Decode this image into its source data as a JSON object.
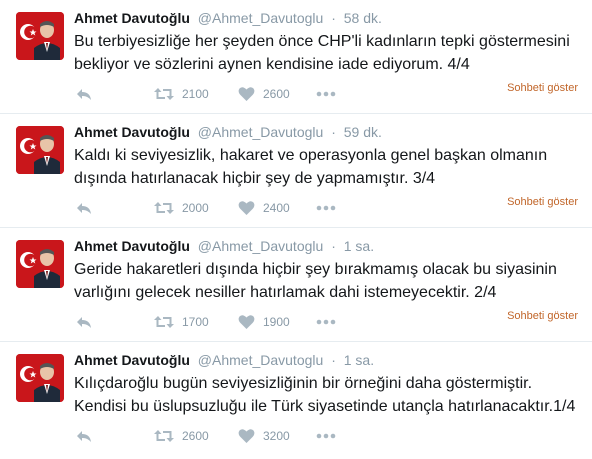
{
  "tweets": [
    {
      "name": "Ahmet Davutoğlu",
      "handle": "@Ahmet_Davutoglu",
      "separator": "·",
      "time": "58 dk.",
      "lines": [
        "Bu terbiyesizliğe her şeyden önce CHP'li kadınların tepki göstermesini",
        "bekliyor ve sözlerini aynen kendisine iade ediyorum. 4/4"
      ],
      "retweets": "2100",
      "likes": "2600",
      "conversation": "Sohbeti göster"
    },
    {
      "name": "Ahmet Davutoğlu",
      "handle": "@Ahmet_Davutoglu",
      "separator": "·",
      "time": "59 dk.",
      "lines": [
        "Kaldı ki seviyesizlik, hakaret ve operasyonla genel başkan olmanın",
        "dışında hatırlanacak hiçbir şey de yapmamıştır. 3/4"
      ],
      "retweets": "2000",
      "likes": "2400",
      "conversation": "Sohbeti göster"
    },
    {
      "name": "Ahmet Davutoğlu",
      "handle": "@Ahmet_Davutoglu",
      "separator": "·",
      "time": "1 sa.",
      "lines": [
        "Geride hakaretleri dışında hiçbir şey bırakmamış olacak bu siyasinin",
        "varlığını gelecek nesiller hatırlamak dahi istemeyecektir. 2/4"
      ],
      "retweets": "1700",
      "likes": "1900",
      "conversation": "Sohbeti göster"
    },
    {
      "name": "Ahmet Davutoğlu",
      "handle": "@Ahmet_Davutoglu",
      "separator": "·",
      "time": "1 sa.",
      "lines": [
        "Kılıçdaroğlu bugün seviyesizliğinin bir örneğini daha göstermiştir.",
        "Kendisi bu üslupsuzluğu ile Türk siyasetinde utançla hatırlanacaktır.1/4"
      ],
      "retweets": "2600",
      "likes": "3200"
    }
  ],
  "icons": {
    "reply": "reply-icon",
    "retweet": "retweet-icon",
    "like": "heart-icon",
    "more": "more-icon"
  },
  "colors": {
    "name": "#14171a",
    "muted": "#8899a6",
    "icon": "#aab8c2",
    "conversation_link": "#c1662a",
    "divider": "#e6ecf0"
  }
}
